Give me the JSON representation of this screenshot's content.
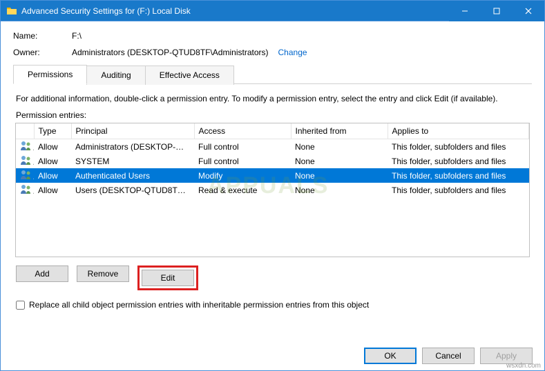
{
  "window": {
    "title": "Advanced Security Settings for (F:) Local Disk"
  },
  "fields": {
    "name_label": "Name:",
    "name_value": "F:\\",
    "owner_label": "Owner:",
    "owner_value": "Administrators (DESKTOP-QTUD8TF\\Administrators)",
    "change_link": "Change"
  },
  "tabs": {
    "permissions": "Permissions",
    "auditing": "Auditing",
    "effective": "Effective Access"
  },
  "info_text": "For additional information, double-click a permission entry. To modify a permission entry, select the entry and click Edit (if available).",
  "entries_label": "Permission entries:",
  "columns": {
    "type": "Type",
    "principal": "Principal",
    "access": "Access",
    "inherited": "Inherited from",
    "applies": "Applies to"
  },
  "rows": [
    {
      "type": "Allow",
      "principal": "Administrators (DESKTOP-QT...",
      "access": "Full control",
      "inherited": "None",
      "applies": "This folder, subfolders and files",
      "selected": false
    },
    {
      "type": "Allow",
      "principal": "SYSTEM",
      "access": "Full control",
      "inherited": "None",
      "applies": "This folder, subfolders and files",
      "selected": false
    },
    {
      "type": "Allow",
      "principal": "Authenticated Users",
      "access": "Modify",
      "inherited": "None",
      "applies": "This folder, subfolders and files",
      "selected": true
    },
    {
      "type": "Allow",
      "principal": "Users (DESKTOP-QTUD8TF\\Us...",
      "access": "Read & execute",
      "inherited": "None",
      "applies": "This folder, subfolders and files",
      "selected": false
    }
  ],
  "buttons": {
    "add": "Add",
    "remove": "Remove",
    "edit": "Edit"
  },
  "checkbox_label": "Replace all child object permission entries with inheritable permission entries from this object",
  "footer": {
    "ok": "OK",
    "cancel": "Cancel",
    "apply": "Apply"
  },
  "watermark": "APPUALS",
  "credit": "wsxdn.com"
}
